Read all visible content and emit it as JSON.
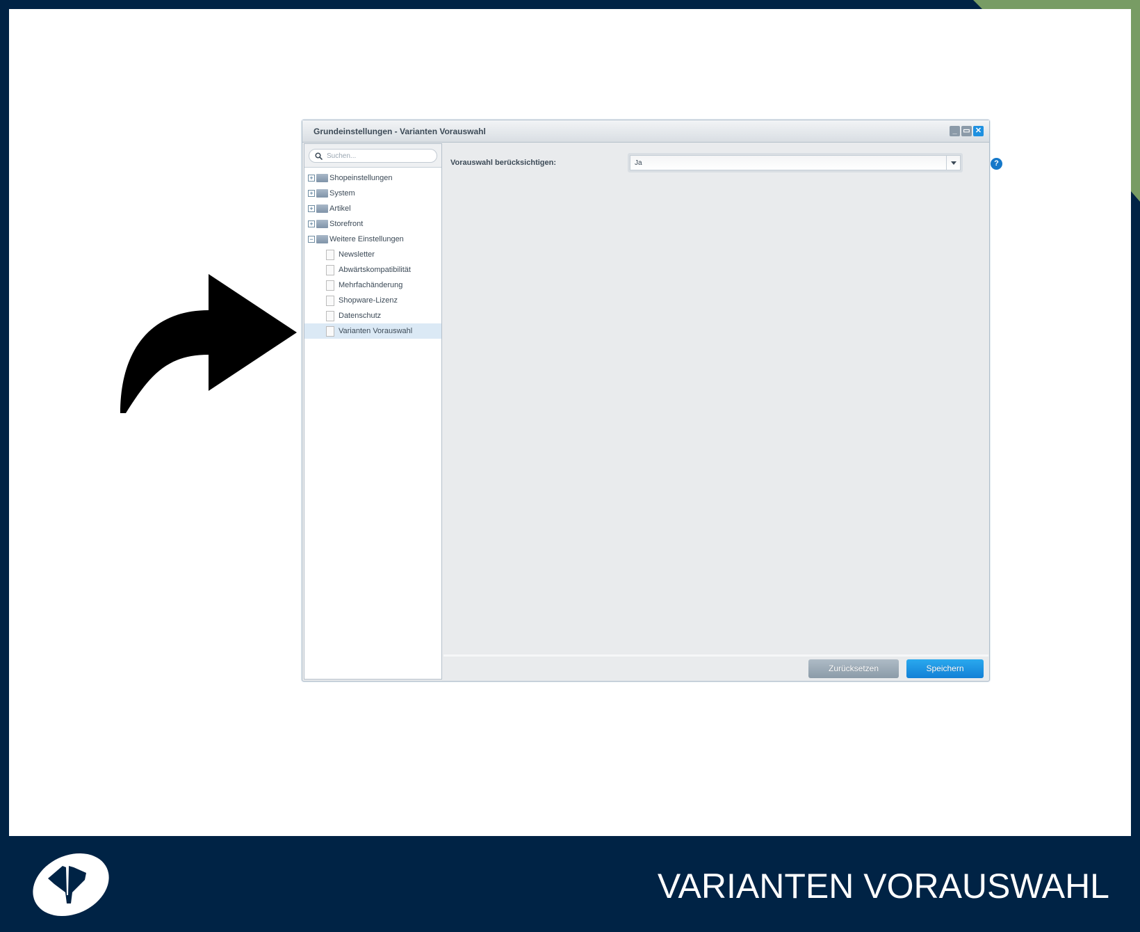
{
  "colors": {
    "navy": "#002345",
    "green": "#789c64",
    "accent": "#1e90e0"
  },
  "window": {
    "title": "Grundeinstellungen - Varianten Vorauswahl",
    "controls": [
      "minimize-icon",
      "maximize-icon",
      "close-icon"
    ],
    "search_placeholder": "Suchen...",
    "tree": [
      {
        "label": "Shopeinstellungen",
        "type": "folder",
        "expanded": false
      },
      {
        "label": "System",
        "type": "folder",
        "expanded": false
      },
      {
        "label": "Artikel",
        "type": "folder",
        "expanded": false
      },
      {
        "label": "Storefront",
        "type": "folder",
        "expanded": false
      },
      {
        "label": "Weitere Einstellungen",
        "type": "folder",
        "expanded": true
      },
      {
        "label": "Newsletter",
        "type": "leaf"
      },
      {
        "label": "Abwärtskompatibilität",
        "type": "leaf"
      },
      {
        "label": "Mehrfachänderung",
        "type": "leaf"
      },
      {
        "label": "Shopware-Lizenz",
        "type": "leaf"
      },
      {
        "label": "Datenschutz",
        "type": "leaf"
      },
      {
        "label": "Varianten Vorauswahl",
        "type": "leaf",
        "selected": true
      }
    ],
    "form": {
      "label": "Vorauswahl berücksichtigen:",
      "value": "Ja",
      "help": "?"
    },
    "buttons": {
      "reset": "Zurücksetzen",
      "save": "Speichern"
    }
  },
  "footer": {
    "title": "VARIANTEN VORAUSWAHL"
  }
}
